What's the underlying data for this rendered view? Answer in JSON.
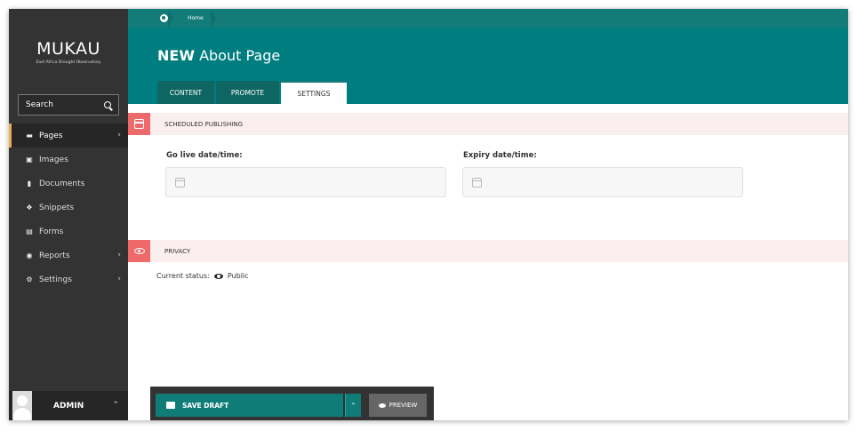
{
  "brand": {
    "name": "MUKAU",
    "subtitle": "East Africa Drought Observatory"
  },
  "breadcrumb": {
    "home": "Home"
  },
  "sidebar": {
    "search_label": "Search",
    "items": [
      {
        "label": "Pages",
        "icon": "folder-open-icon",
        "active": true,
        "has_chevron": true
      },
      {
        "label": "Images",
        "icon": "image-icon",
        "active": false,
        "has_chevron": false
      },
      {
        "label": "Documents",
        "icon": "document-icon",
        "active": false,
        "has_chevron": false
      },
      {
        "label": "Snippets",
        "icon": "snippet-icon",
        "active": false,
        "has_chevron": false
      },
      {
        "label": "Forms",
        "icon": "form-icon",
        "active": false,
        "has_chevron": false
      },
      {
        "label": "Reports",
        "icon": "globe-icon",
        "active": false,
        "has_chevron": true
      },
      {
        "label": "Settings",
        "icon": "cogs-icon",
        "active": false,
        "has_chevron": true
      }
    ],
    "user": "ADMIN"
  },
  "header": {
    "title_prefix": "NEW",
    "title": "About Page",
    "tabs": [
      {
        "label": "CONTENT",
        "active": false
      },
      {
        "label": "PROMOTE",
        "active": false
      },
      {
        "label": "SETTINGS",
        "active": true
      }
    ]
  },
  "scheduled": {
    "heading": "SCHEDULED PUBLISHING",
    "go_live_label": "Go live date/time:",
    "expiry_label": "Expiry date/time:",
    "go_live_value": "",
    "expiry_value": ""
  },
  "privacy": {
    "heading": "PRIVACY",
    "status_label": "Current status:",
    "status_value": "Public"
  },
  "actions": {
    "save_draft": "SAVE DRAFT",
    "preview": "PREVIEW"
  },
  "colors": {
    "teal": "#007d7e",
    "sidebar": "#333333",
    "section_accent": "#ee6a6a",
    "section_bg": "#fbeeee",
    "active_marker": "#e9b04d"
  }
}
